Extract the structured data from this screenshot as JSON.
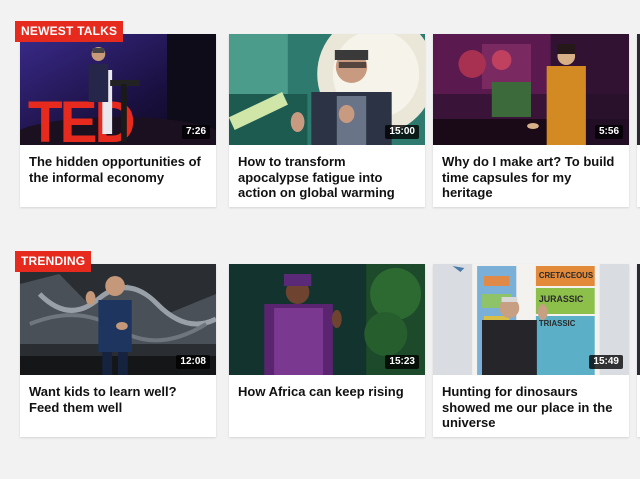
{
  "sections": [
    {
      "label": "NEWEST TALKS",
      "talks": [
        {
          "title": "The hidden opportunities of the informal economy",
          "duration": "7:26"
        },
        {
          "title": "How to transform apocalypse fatigue into action on global warming",
          "duration": "15:00"
        },
        {
          "title": "Why do I make art? To build time capsules for my heritage",
          "duration": "5:56"
        }
      ]
    },
    {
      "label": "TRENDING",
      "talks": [
        {
          "title": "Want kids to learn well? Feed them well",
          "duration": "12:08"
        },
        {
          "title": "How Africa can keep rising",
          "duration": "15:23"
        },
        {
          "title": "Hunting for dinosaurs showed me our place in the universe",
          "duration": "15:49"
        }
      ]
    }
  ],
  "stage_logo_text": "TED",
  "slide_text": [
    "CRETACEOUS",
    "JURASSIC",
    "TRIASSIC"
  ],
  "colors": {
    "accent": "#e62b1e",
    "page_bg": "#f2f2f2",
    "card_bg": "#ffffff"
  }
}
